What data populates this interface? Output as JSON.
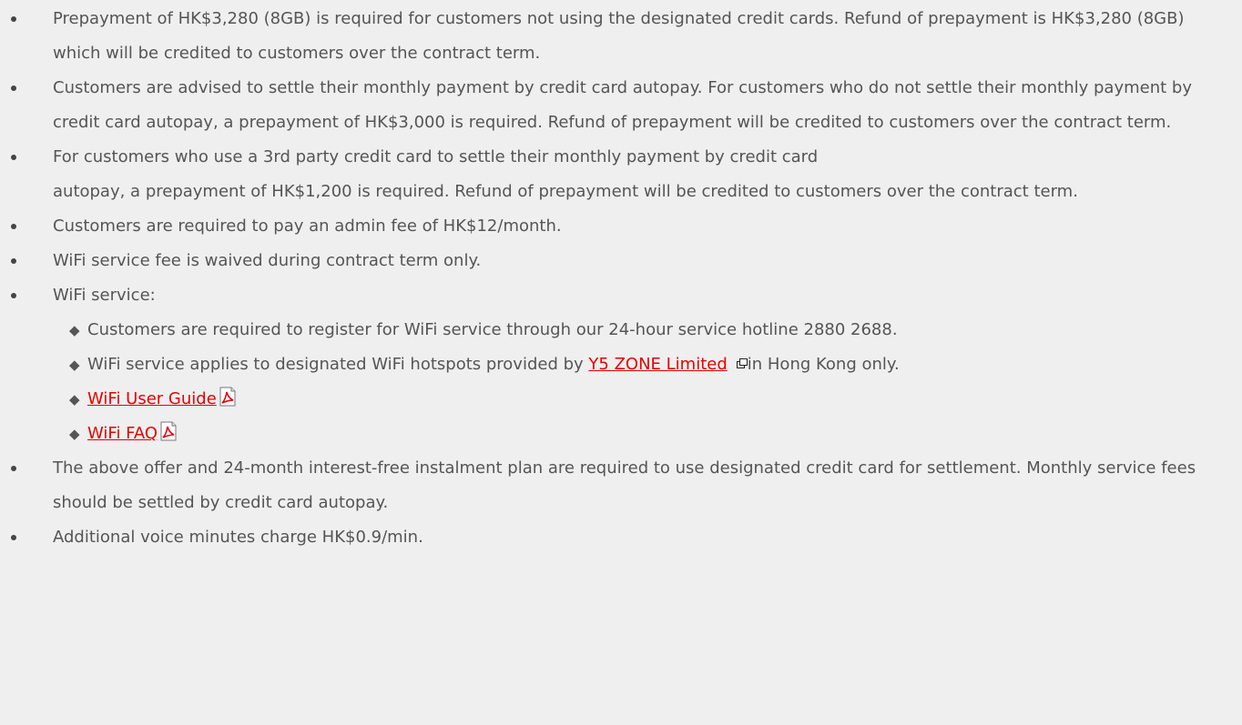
{
  "terms": {
    "items": [
      {
        "text": "Prepayment of HK$3,280 (8GB) is required for customers not using the designated credit cards. Refund of prepayment is HK$3,280 (8GB) which will be credited to customers over the contract term."
      },
      {
        "text": "Customers are advised to settle their monthly payment by credit card autopay. For customers who do not settle their monthly payment by credit card autopay, a prepayment of HK$3,000 is required. Refund of prepayment will be credited to customers over the contract term."
      },
      {
        "line1": "For customers who use a 3rd party credit card to settle their monthly payment by credit card",
        "line2": "autopay, a prepayment of HK$1,200 is required. Refund of prepayment will be credited to customers over the contract term."
      },
      {
        "text": "Customers are required to pay an admin fee of HK$12/month."
      },
      {
        "text": "WiFi service fee is waived during contract term only."
      },
      {
        "text": "WiFi service:",
        "sub": {
          "hotline": "Customers are required to register for WiFi service through our 24-hour service hotline 2880 2688.",
          "hotspots_before": "WiFi service applies to designated WiFi hotspots provided by ",
          "hotspots_link": "Y5 ZONE Limited",
          "hotspots_after": "in Hong Kong only.",
          "user_guide": "WiFi User Guide",
          "faq": "WiFi FAQ"
        }
      },
      {
        "text": "The above offer and 24-month interest-free instalment plan are required to use designated credit card for settlement. Monthly service fees should be settled by credit card autopay."
      },
      {
        "text": "Additional voice minutes charge HK$0.9/min."
      }
    ]
  },
  "icons": {
    "bullet": "disc",
    "sub_bullet": "black-diamond",
    "sub_bullet_glyph": "◆",
    "external": "new-window-icon",
    "pdf": "pdf-icon"
  },
  "colors": {
    "background": "#efefef",
    "text": "#555555",
    "link": "#e60000",
    "pdf_red": "#e30613"
  }
}
